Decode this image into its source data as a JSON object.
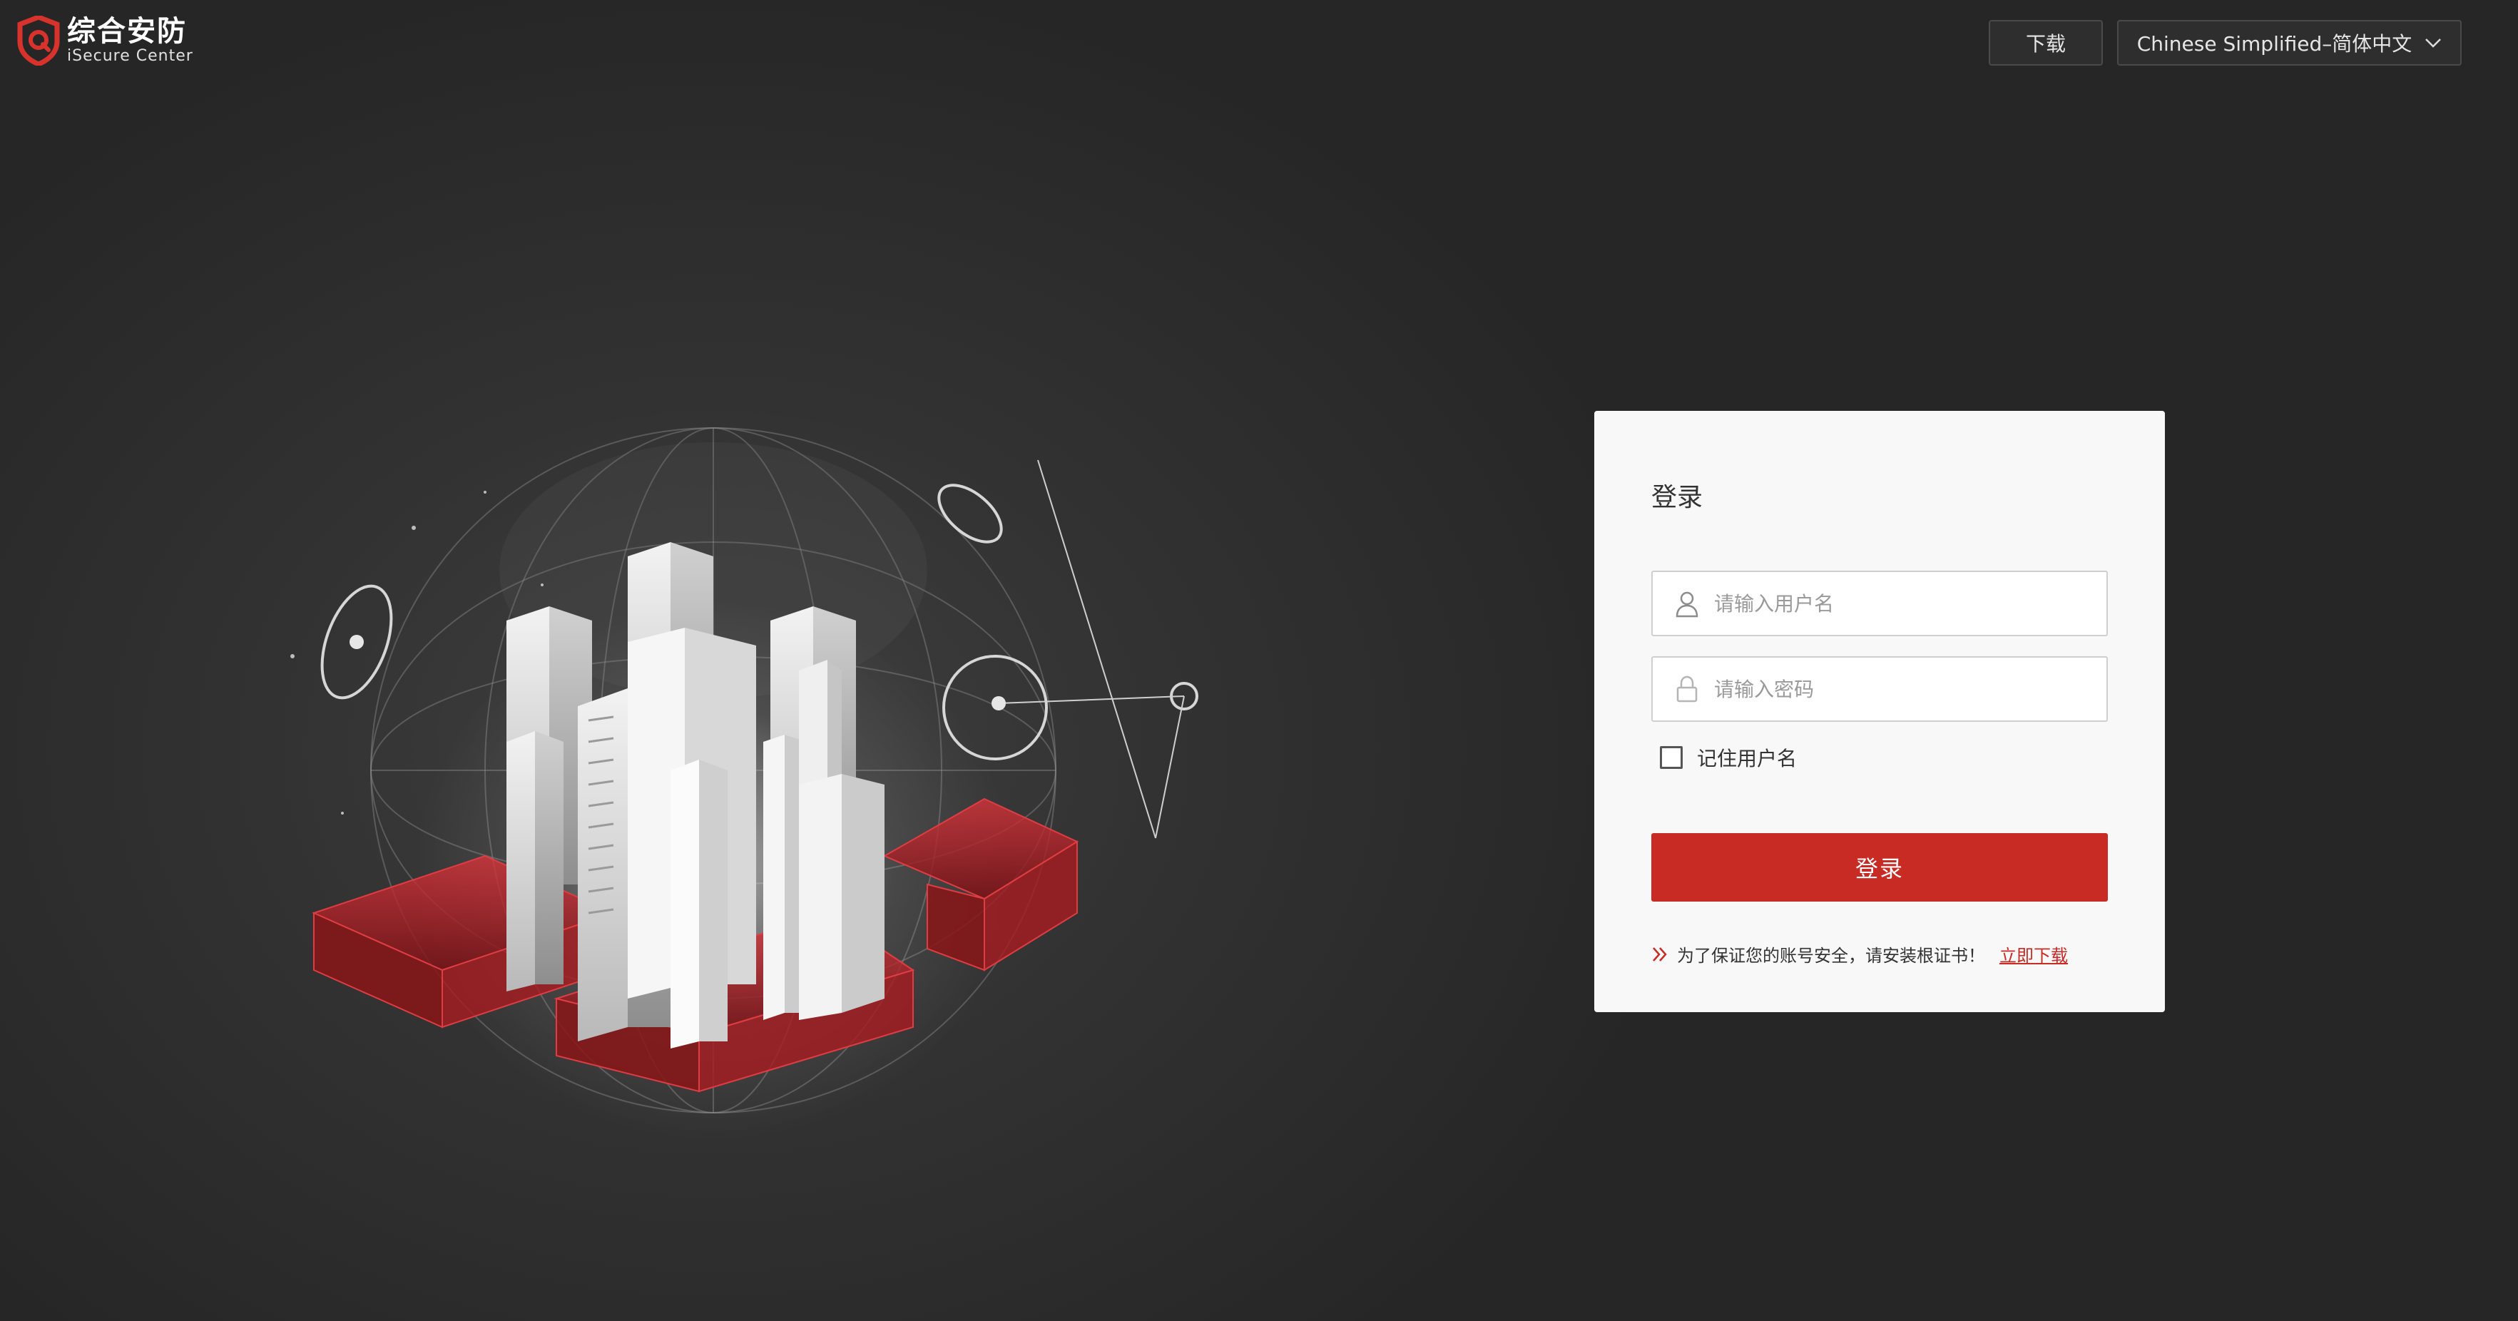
{
  "header": {
    "logo_cn": "综合安防",
    "logo_en": "iSecure Center",
    "download_label": "下载",
    "language_selected": "Chinese Simplified–简体中文"
  },
  "login": {
    "title": "登录",
    "username_placeholder": "请输入用户名",
    "password_placeholder": "请输入密码",
    "remember_label": "记住用户名",
    "remember_checked": false,
    "submit_label": "登录",
    "notice_text": "为了保证您的账号安全，请安装根证书！",
    "notice_link": "立即下载"
  },
  "colors": {
    "accent": "#c82a24",
    "background": "#2f2f2f",
    "card": "#f8f8f8"
  },
  "icons": {
    "logo": "shield-logo-icon",
    "language": "chevron-down-icon",
    "username": "user-icon",
    "password": "lock-icon",
    "notice": "double-chevron-icon"
  }
}
